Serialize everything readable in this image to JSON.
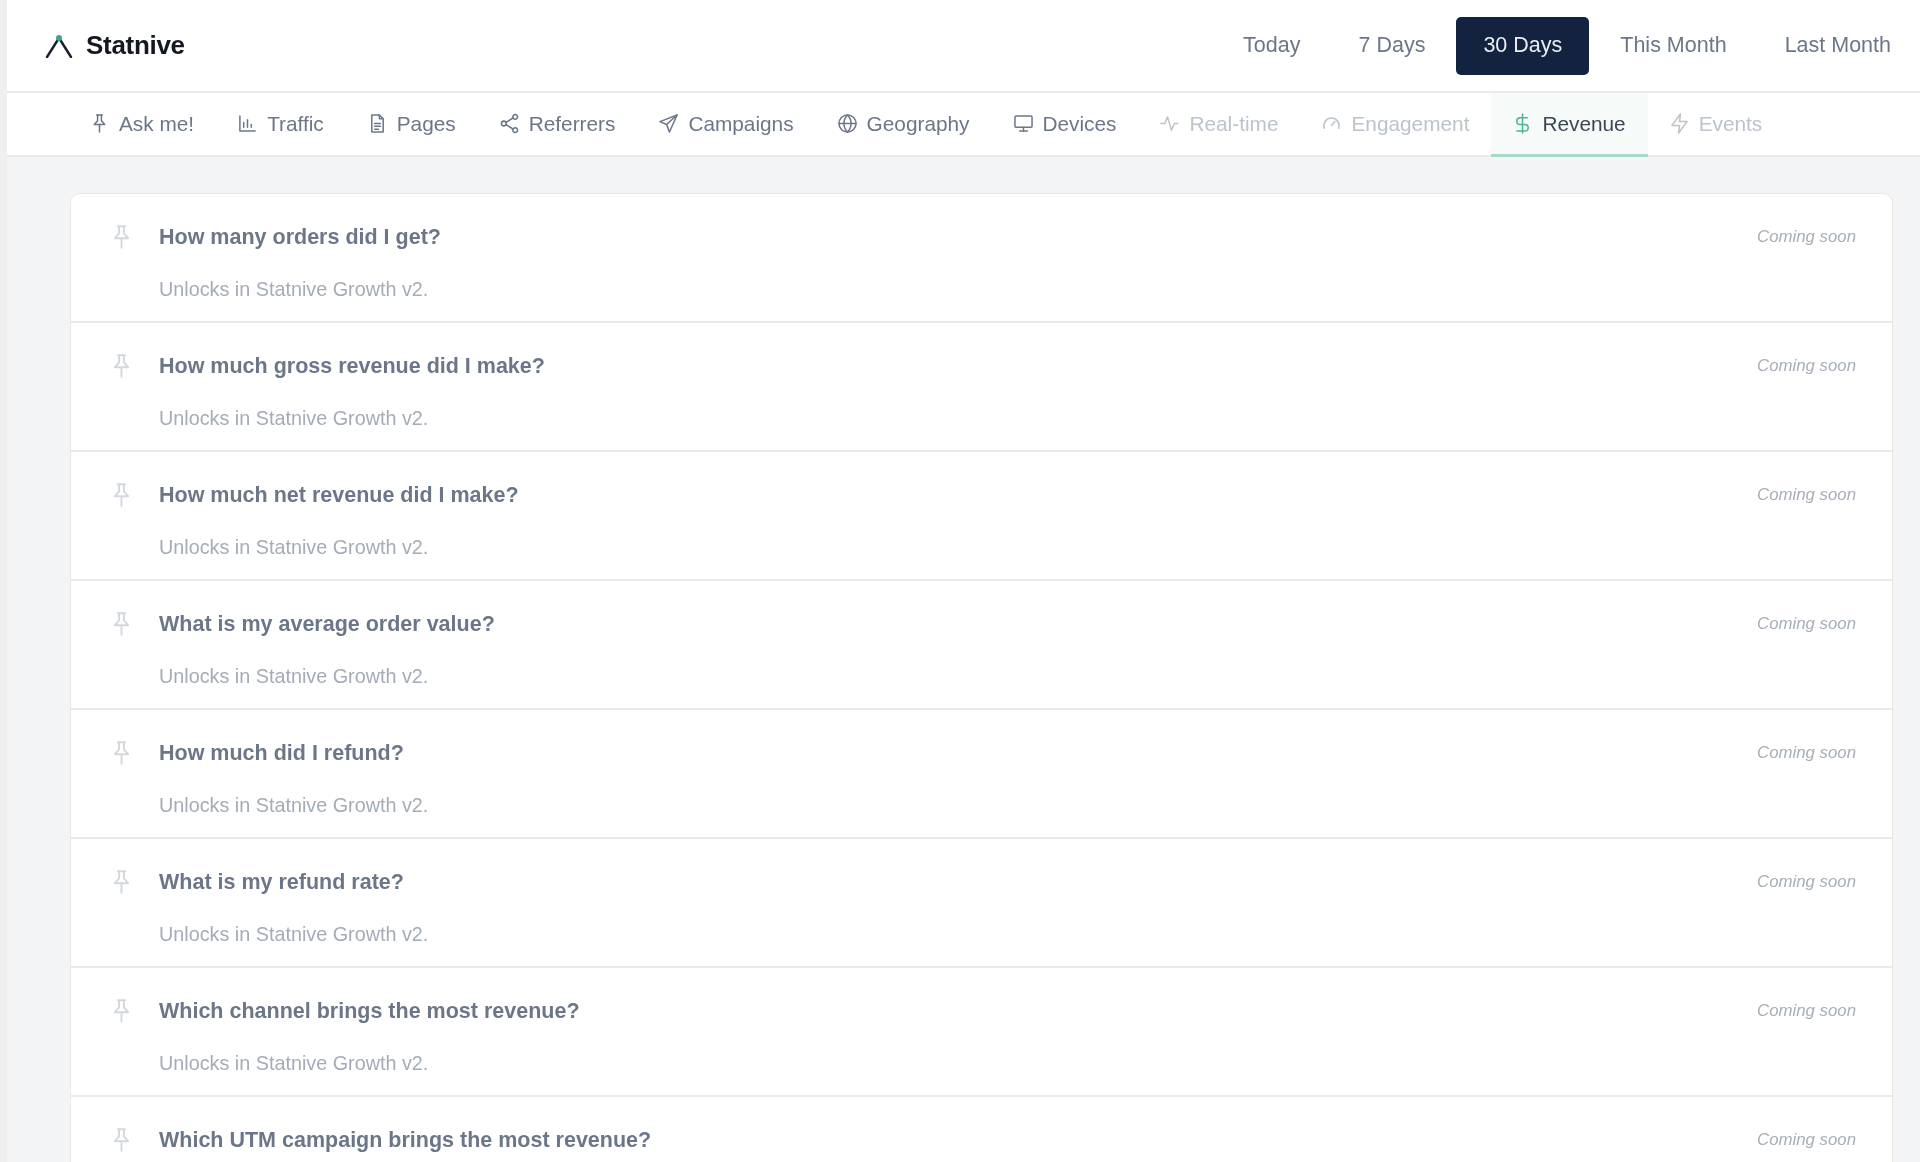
{
  "brand": {
    "name": "Statnive"
  },
  "date_ranges": [
    {
      "label": "Today",
      "selected": false
    },
    {
      "label": "7 Days",
      "selected": false
    },
    {
      "label": "30 Days",
      "selected": true
    },
    {
      "label": "This Month",
      "selected": false
    },
    {
      "label": "Last Month",
      "selected": false
    }
  ],
  "tabs": [
    {
      "label": "Ask me!",
      "selected": false,
      "disabled": false
    },
    {
      "label": "Traffic",
      "selected": false,
      "disabled": false
    },
    {
      "label": "Pages",
      "selected": false,
      "disabled": false
    },
    {
      "label": "Referrers",
      "selected": false,
      "disabled": false
    },
    {
      "label": "Campaigns",
      "selected": false,
      "disabled": false
    },
    {
      "label": "Geography",
      "selected": false,
      "disabled": false
    },
    {
      "label": "Devices",
      "selected": false,
      "disabled": false
    },
    {
      "label": "Real-time",
      "selected": false,
      "disabled": true
    },
    {
      "label": "Engagement",
      "selected": false,
      "disabled": true
    },
    {
      "label": "Revenue",
      "selected": true,
      "disabled": false
    },
    {
      "label": "Events",
      "selected": false,
      "disabled": true
    }
  ],
  "questions": [
    {
      "title": "How many orders did I get?",
      "note": "Unlocks in Statnive Growth v2.",
      "status": "Coming soon"
    },
    {
      "title": "How much gross revenue did I make?",
      "note": "Unlocks in Statnive Growth v2.",
      "status": "Coming soon"
    },
    {
      "title": "How much net revenue did I make?",
      "note": "Unlocks in Statnive Growth v2.",
      "status": "Coming soon"
    },
    {
      "title": "What is my average order value?",
      "note": "Unlocks in Statnive Growth v2.",
      "status": "Coming soon"
    },
    {
      "title": "How much did I refund?",
      "note": "Unlocks in Statnive Growth v2.",
      "status": "Coming soon"
    },
    {
      "title": "What is my refund rate?",
      "note": "Unlocks in Statnive Growth v2.",
      "status": "Coming soon"
    },
    {
      "title": "Which channel brings the most revenue?",
      "note": "Unlocks in Statnive Growth v2.",
      "status": "Coming soon"
    },
    {
      "title": "Which UTM campaign brings the most revenue?",
      "status": "Coming soon"
    }
  ]
}
